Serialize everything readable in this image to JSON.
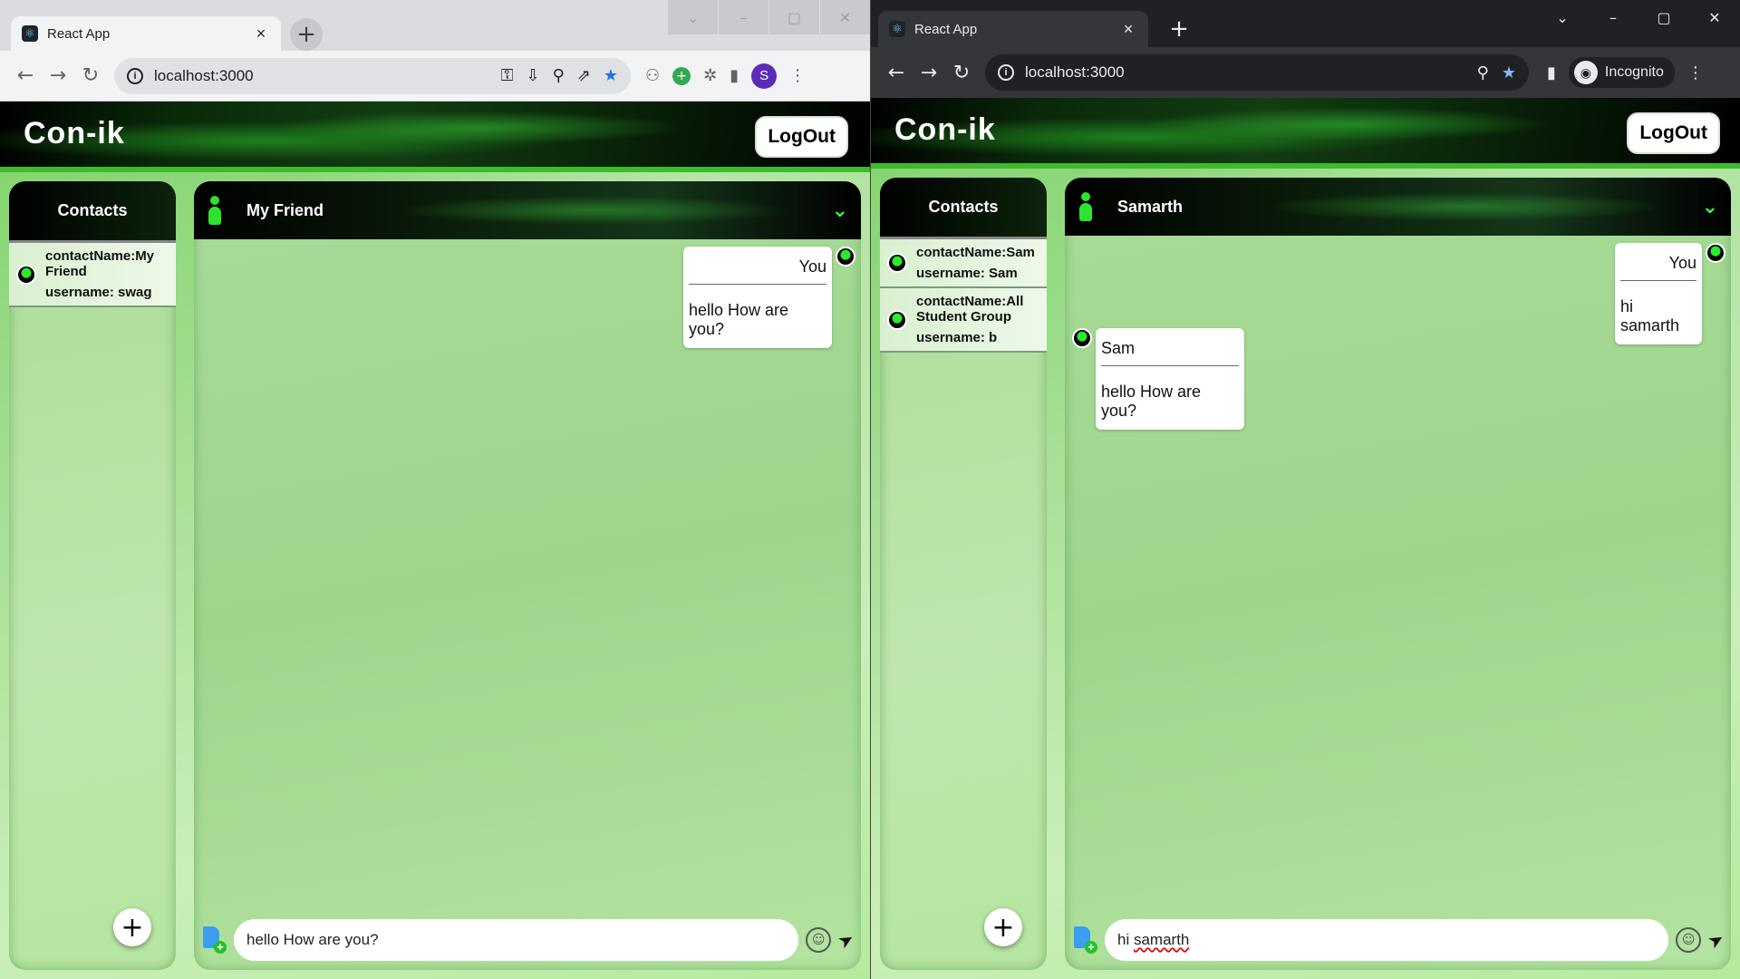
{
  "left": {
    "tab_title": "React App",
    "url": "localhost:3000",
    "profile_initial": "S",
    "app": {
      "brand": "Con-ik",
      "logout": "LogOut",
      "contacts_title": "Contacts",
      "contacts": [
        {
          "contact_name": "contactName:My Friend",
          "username": "username: swag"
        }
      ],
      "chat_title": "My Friend",
      "messages": [
        {
          "sender": "You",
          "text": "hello How are you?",
          "mine": true
        }
      ],
      "input_value": "hello How are you?"
    }
  },
  "right": {
    "tab_title": "React App",
    "url": "localhost:3000",
    "incognito_label": "Incognito",
    "app": {
      "brand": "Con-ik",
      "logout": "LogOut",
      "contacts_title": "Contacts",
      "contacts": [
        {
          "contact_name": "contactName:Sam",
          "username": "username: Sam"
        },
        {
          "contact_name": "contactName:All Student Group",
          "username": "username: b"
        }
      ],
      "chat_title": "Samarth",
      "messages": [
        {
          "sender": "You",
          "text": "hi samarth",
          "mine": true
        },
        {
          "sender": "Sam",
          "text": "hello How are you?",
          "mine": false
        }
      ],
      "input_prefix": "hi",
      "input_misspelled": "samarth"
    }
  }
}
